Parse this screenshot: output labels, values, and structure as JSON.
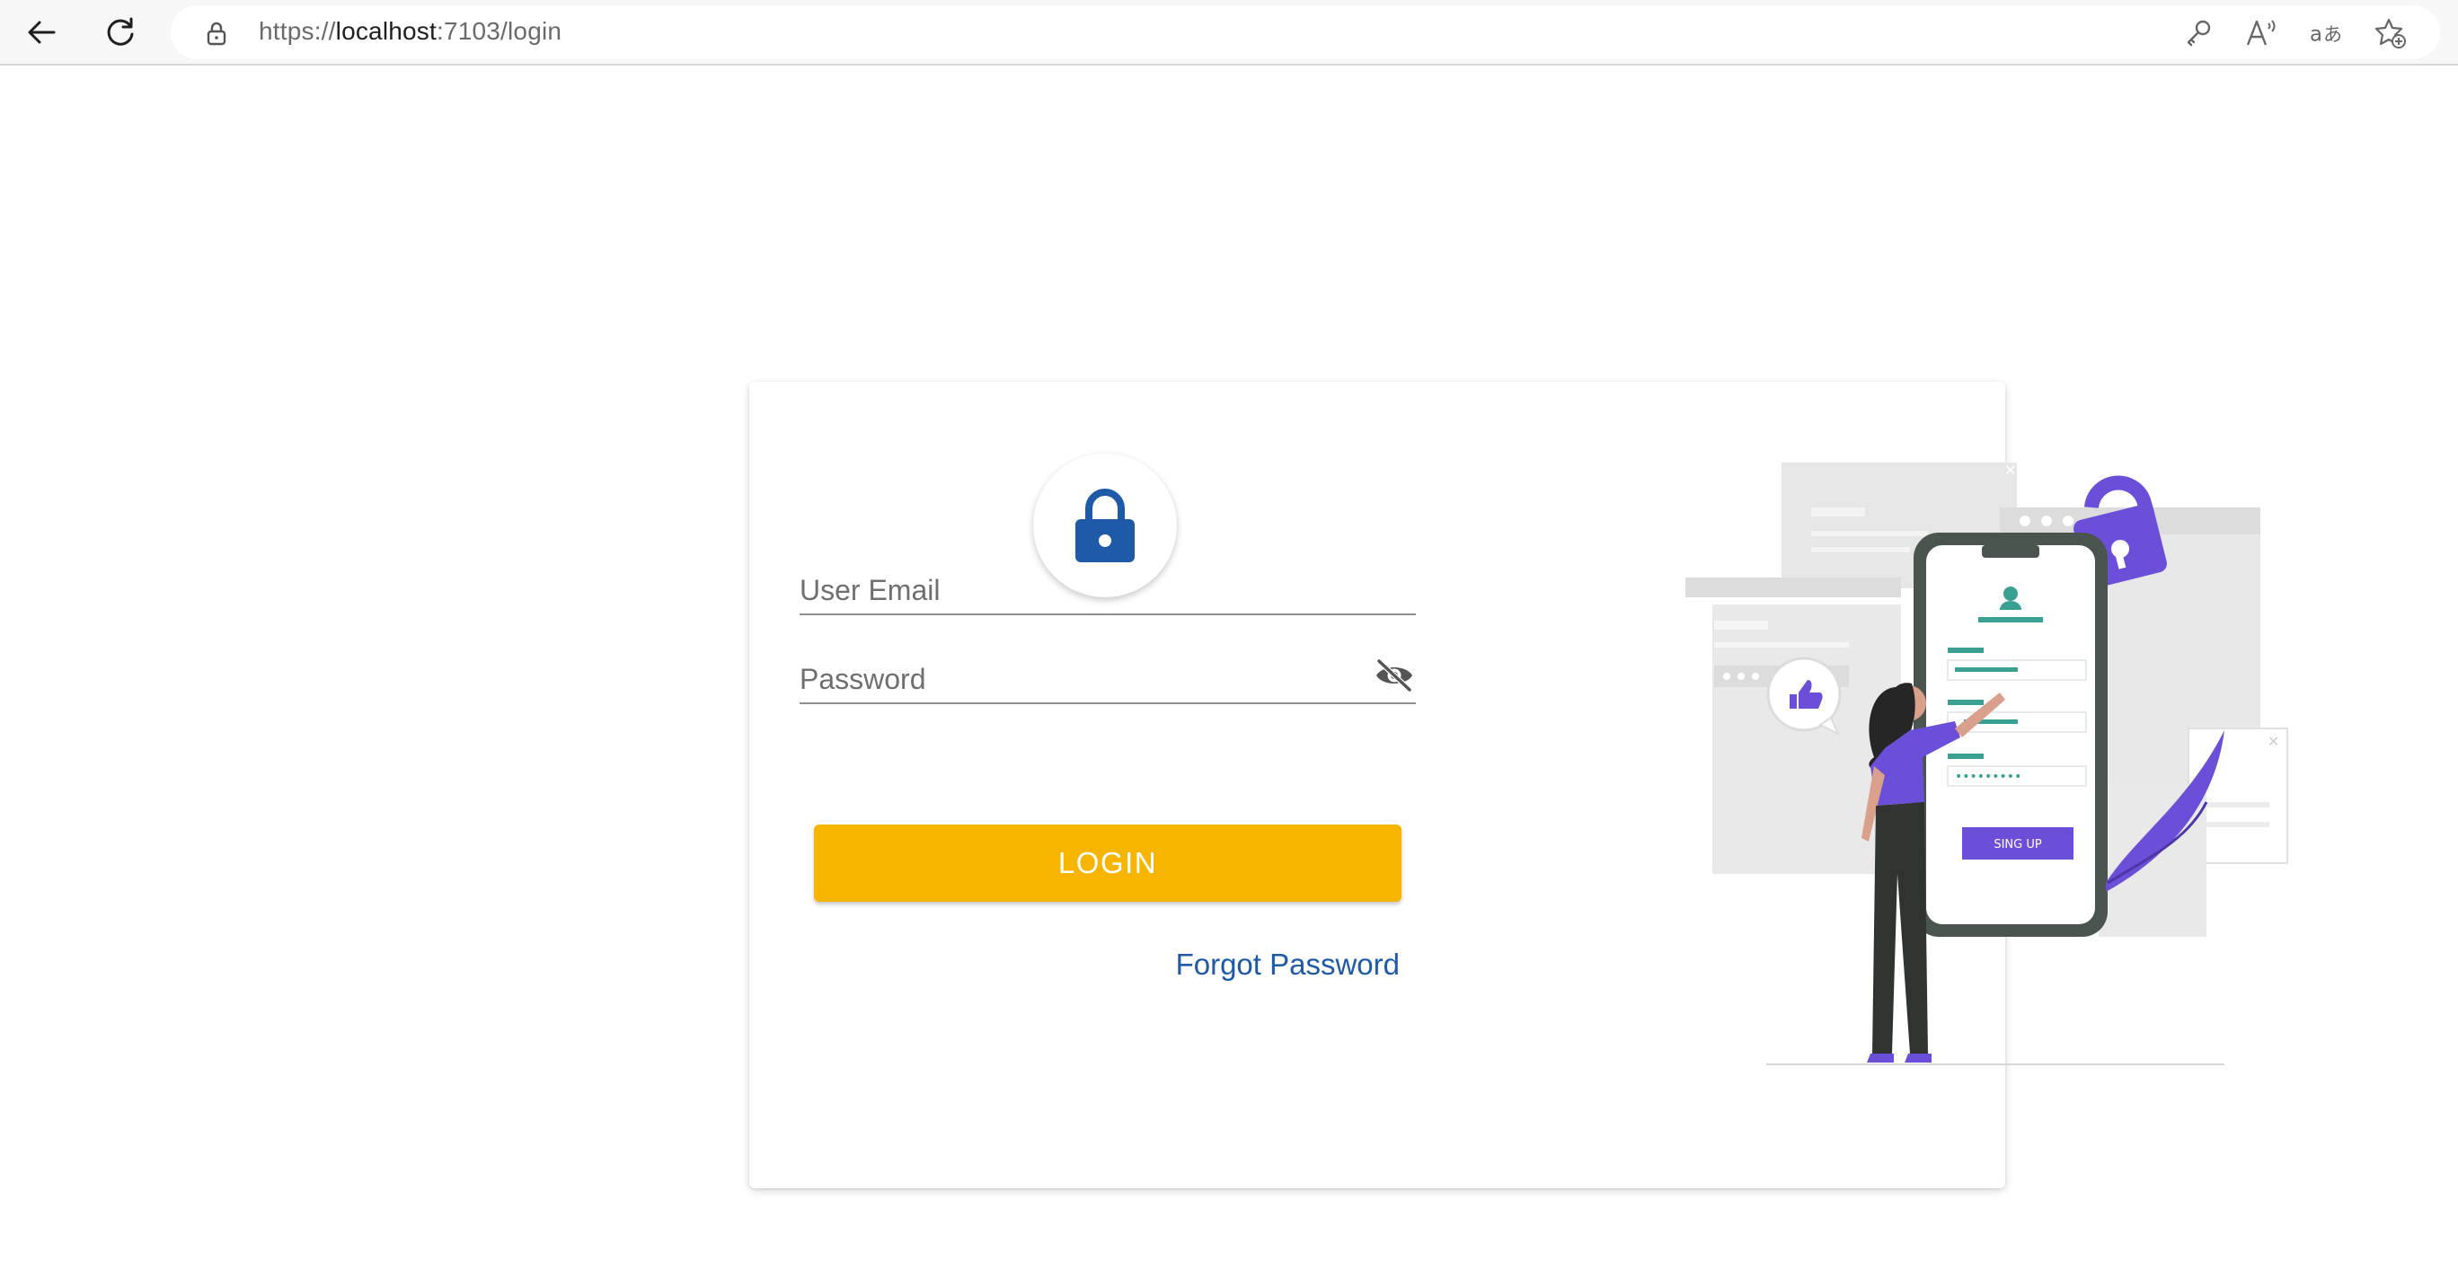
{
  "browser": {
    "url_prefix": "https://",
    "url_host": "localhost",
    "url_rest": ":7103/login",
    "icons": [
      "back-arrow-icon",
      "refresh-icon",
      "lock-icon",
      "key-icon",
      "read-aloud-icon",
      "translate-icon",
      "favorites-icon"
    ]
  },
  "login": {
    "email_placeholder": "User Email",
    "password_placeholder": "Password",
    "login_label": "LOGIN",
    "forgot_label": "Forgot Password",
    "accent_color": "#f7b500",
    "link_color": "#1e5aa8"
  },
  "illustration": {
    "phone_button": "SING UP"
  }
}
